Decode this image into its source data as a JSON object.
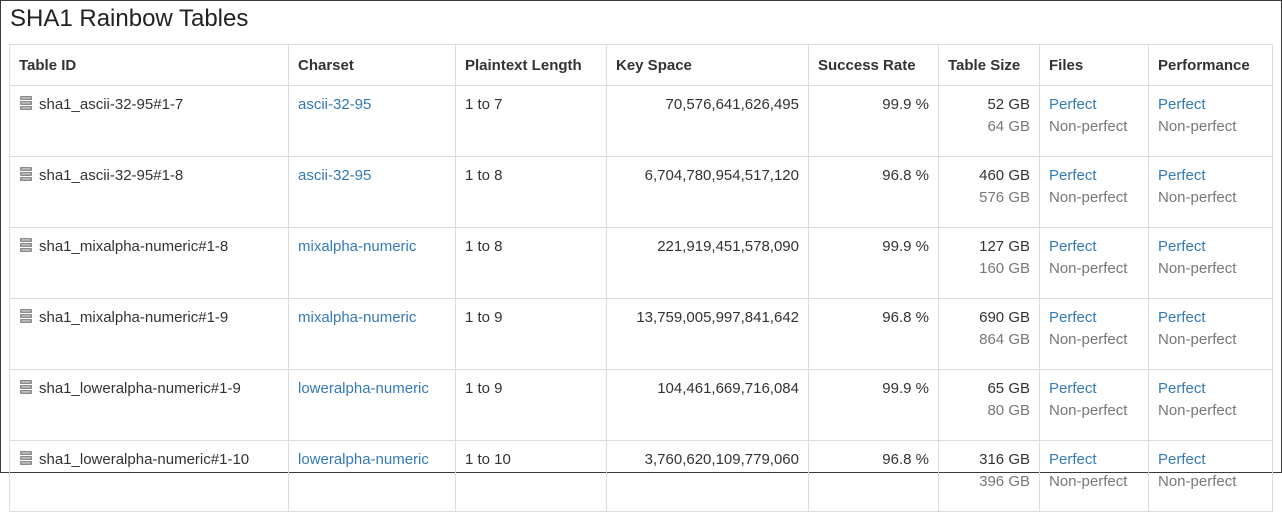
{
  "page": {
    "title": "SHA1 Rainbow Tables"
  },
  "table": {
    "headers": [
      "Table ID",
      "Charset",
      "Plaintext Length",
      "Key Space",
      "Success Rate",
      "Table Size",
      "Files",
      "Performance"
    ],
    "rows": [
      {
        "icon": "database-icon",
        "table_id": "sha1_ascii-32-95#1-7",
        "charset": "ascii-32-95",
        "plaintext_length": "1 to 7",
        "key_space": "70,576,641,626,495",
        "success_rate": "99.9 %",
        "size_perfect": "52 GB",
        "size_nonperfect": "64 GB",
        "files_perfect": "Perfect",
        "files_nonperfect": "Non-perfect",
        "perf_perfect": "Perfect",
        "perf_nonperfect": "Non-perfect"
      },
      {
        "icon": "database-icon",
        "table_id": "sha1_ascii-32-95#1-8",
        "charset": "ascii-32-95",
        "plaintext_length": "1 to 8",
        "key_space": "6,704,780,954,517,120",
        "success_rate": "96.8 %",
        "size_perfect": "460 GB",
        "size_nonperfect": "576 GB",
        "files_perfect": "Perfect",
        "files_nonperfect": "Non-perfect",
        "perf_perfect": "Perfect",
        "perf_nonperfect": "Non-perfect"
      },
      {
        "icon": "database-icon",
        "table_id": "sha1_mixalpha-numeric#1-8",
        "charset": "mixalpha-numeric",
        "plaintext_length": "1 to 8",
        "key_space": "221,919,451,578,090",
        "success_rate": "99.9 %",
        "size_perfect": "127 GB",
        "size_nonperfect": "160 GB",
        "files_perfect": "Perfect",
        "files_nonperfect": "Non-perfect",
        "perf_perfect": "Perfect",
        "perf_nonperfect": "Non-perfect"
      },
      {
        "icon": "database-icon",
        "table_id": "sha1_mixalpha-numeric#1-9",
        "charset": "mixalpha-numeric",
        "plaintext_length": "1 to 9",
        "key_space": "13,759,005,997,841,642",
        "success_rate": "96.8 %",
        "size_perfect": "690 GB",
        "size_nonperfect": "864 GB",
        "files_perfect": "Perfect",
        "files_nonperfect": "Non-perfect",
        "perf_perfect": "Perfect",
        "perf_nonperfect": "Non-perfect"
      },
      {
        "icon": "database-icon",
        "table_id": "sha1_loweralpha-numeric#1-9",
        "charset": "loweralpha-numeric",
        "plaintext_length": "1 to 9",
        "key_space": "104,461,669,716,084",
        "success_rate": "99.9 %",
        "size_perfect": "65 GB",
        "size_nonperfect": "80 GB",
        "files_perfect": "Perfect",
        "files_nonperfect": "Non-perfect",
        "perf_perfect": "Perfect",
        "perf_nonperfect": "Non-perfect"
      },
      {
        "icon": "database-icon",
        "table_id": "sha1_loweralpha-numeric#1-10",
        "charset": "loweralpha-numeric",
        "plaintext_length": "1 to 10",
        "key_space": "3,760,620,109,779,060",
        "success_rate": "96.8 %",
        "size_perfect": "316 GB",
        "size_nonperfect": "396 GB",
        "files_perfect": "Perfect",
        "files_nonperfect": "Non-perfect",
        "perf_perfect": "Perfect",
        "perf_nonperfect": "Non-perfect"
      }
    ]
  },
  "colors": {
    "link": "#337ab7",
    "muted": "#777777",
    "text": "#333333",
    "border": "#dddddd"
  }
}
